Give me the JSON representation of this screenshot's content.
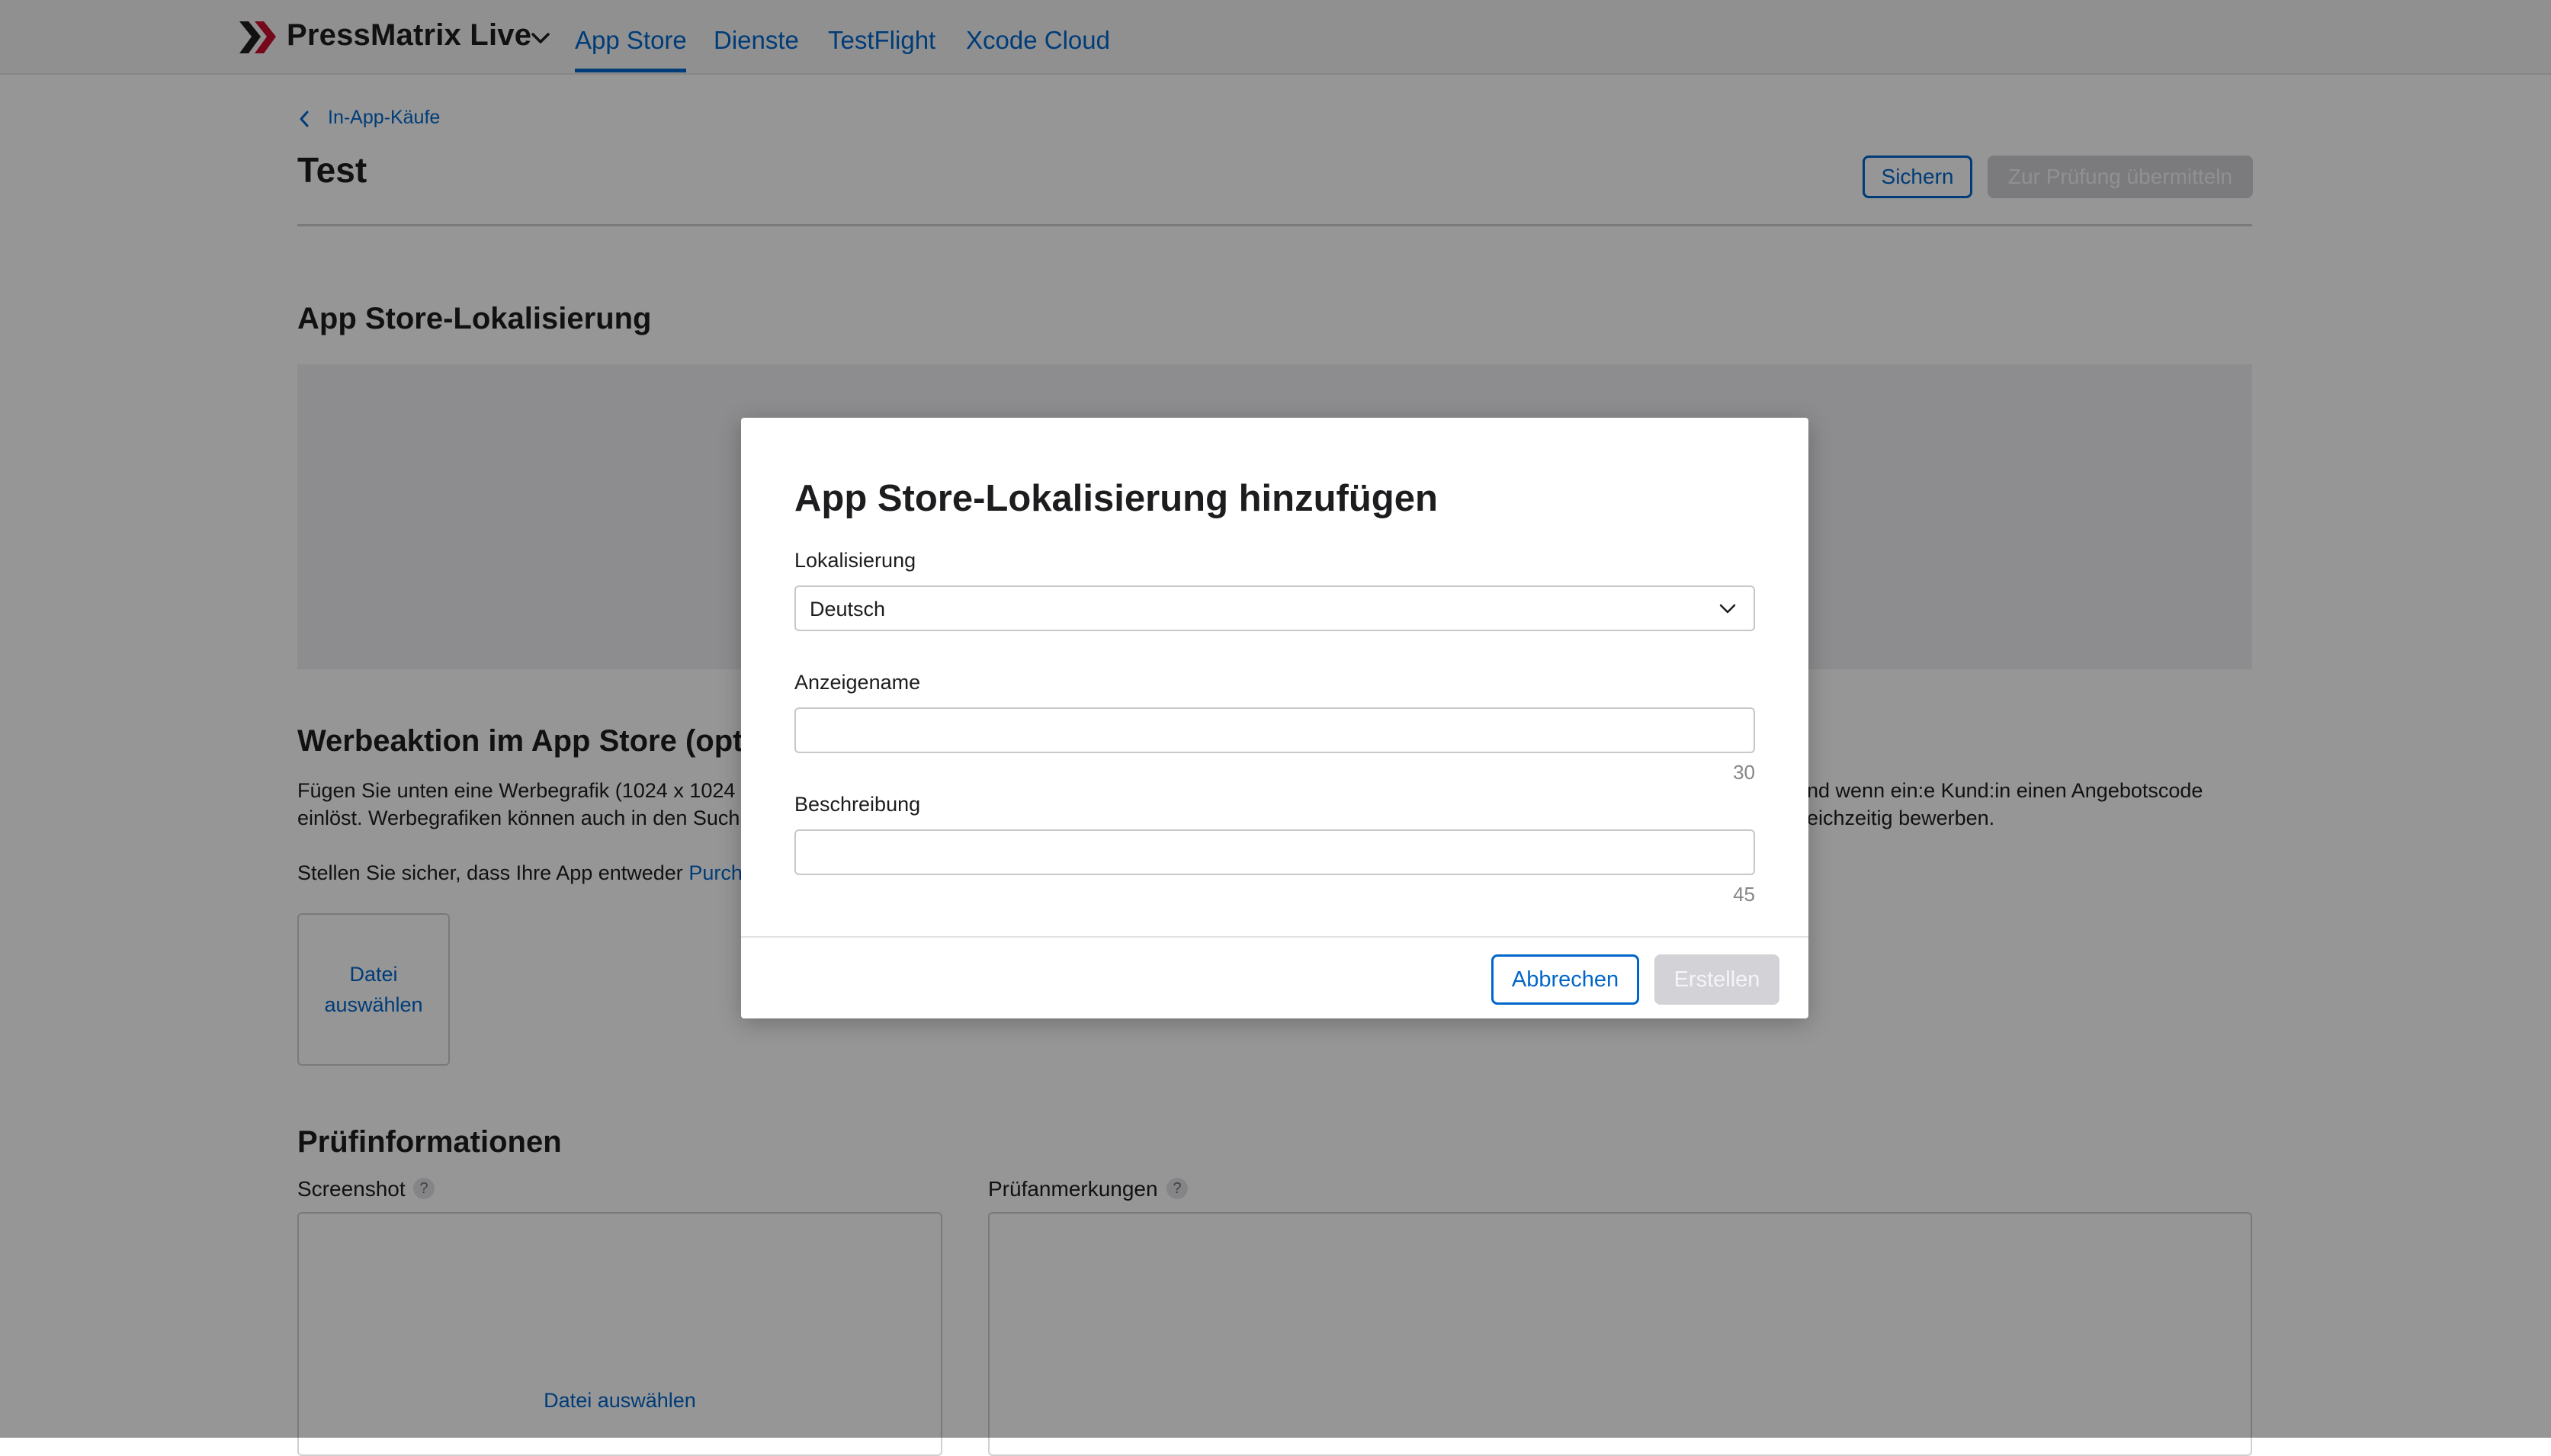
{
  "nav": {
    "brand": "PressMatrix Live",
    "tabs": [
      {
        "label": "App Store",
        "active": true
      },
      {
        "label": "Dienste"
      },
      {
        "label": "TestFlight"
      },
      {
        "label": "Xcode Cloud"
      }
    ]
  },
  "page": {
    "breadcrumb": "In-App-Käufe",
    "title": "Test",
    "save_label": "Sichern",
    "submit_label": "Zur Prüfung übermitteln"
  },
  "localization": {
    "heading": "App Store-Lokalisierung"
  },
  "promo": {
    "heading": "Werbeaktion im App Store (opt",
    "line1_start": "Fügen Sie unten eine Werbegrafik (1024 x 1024",
    "line1_end": "nd wenn ein:e Kund:in einen Angebotscode",
    "line2_start": "einlöst. Werbegrafiken können auch in den Such",
    "line2_end": "eichzeitig bewerben.",
    "line3_start": "Stellen Sie sicher, dass Ihre App entweder ",
    "line3_link": "Purch",
    "file_label": "Datei auswählen"
  },
  "review": {
    "heading": "Prüfinformationen",
    "screenshot_label": "Screenshot",
    "notes_label": "Prüfanmerkungen",
    "help": "?",
    "file_label": "Datei auswählen"
  },
  "modal": {
    "title": "App Store-Lokalisierung hinzufügen",
    "locale_label": "Lokalisierung",
    "locale_value": "Deutsch",
    "display_name_label": "Anzeigename",
    "display_name_value": "",
    "display_name_counter": "30",
    "description_label": "Beschreibung",
    "description_value": "",
    "description_counter": "45",
    "cancel_label": "Abbrechen",
    "create_label": "Erstellen"
  },
  "colors": {
    "accent": "#0066cc",
    "brand_red": "#c8102e",
    "disabled": "#d2d2d7"
  }
}
